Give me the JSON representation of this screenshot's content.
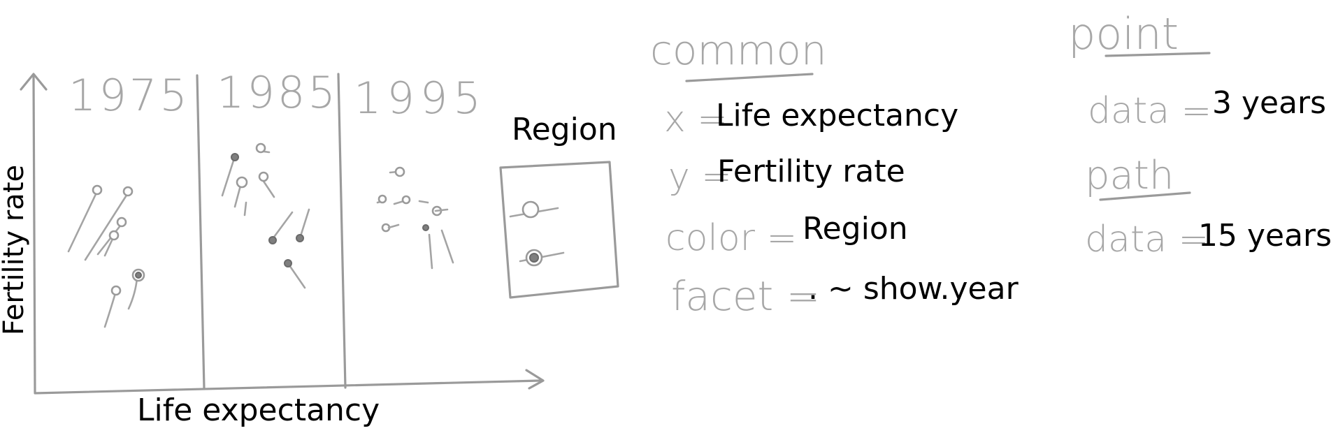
{
  "sketch": {
    "facets": [
      "1975",
      "1985",
      "1995"
    ],
    "x_label": "Life expectancy",
    "y_label": "Fertility rate",
    "legend_title": "Region"
  },
  "common": {
    "heading": "common",
    "x_key": "x =",
    "x_value": "Life expectancy",
    "y_key": "y =",
    "y_value": "Fertility rate",
    "color_key": "color =",
    "color_value": "Region",
    "facet_key": "facet =",
    "facet_value": ". ~ show.year"
  },
  "point": {
    "heading": "point",
    "data_key": "data =",
    "data_value": "3 years"
  },
  "path": {
    "heading": "path",
    "data_key": "data =",
    "data_value": "15 years"
  },
  "colors": {
    "ink": "#9a9a9a",
    "text": "#000000",
    "filled_dot": "#7f7f7f"
  }
}
